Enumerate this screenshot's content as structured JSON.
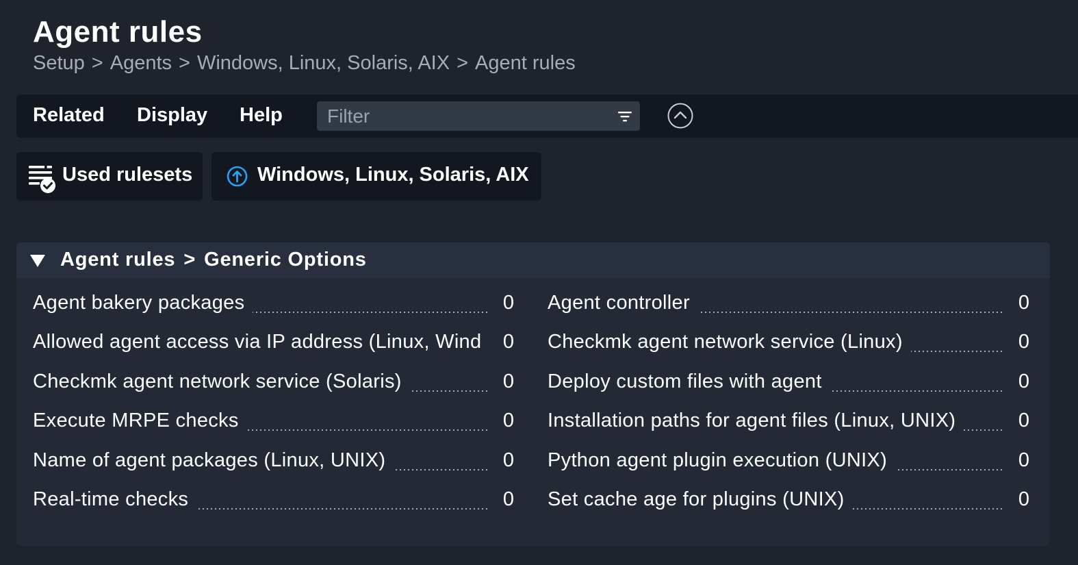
{
  "page": {
    "title": "Agent rules",
    "breadcrumb": [
      "Setup",
      "Agents",
      "Windows, Linux, Solaris, AIX",
      "Agent rules"
    ],
    "breadcrumb_separator": ">"
  },
  "menubar": {
    "items": [
      "Related",
      "Display",
      "Help"
    ],
    "filter_placeholder": "Filter",
    "filter_icon": "filter-lines-icon",
    "collapse_icon": "chevron-up-circle-icon"
  },
  "buttons": [
    {
      "label": "Used rulesets",
      "icon": "ruleset-check-icon"
    },
    {
      "label": "Windows, Linux, Solaris, AIX",
      "icon": "arrow-up-circle-icon"
    }
  ],
  "section": {
    "title_parts": [
      "Agent rules",
      ">",
      "Generic Options"
    ],
    "expanded": true,
    "rules_left": [
      {
        "name": "Agent bakery packages",
        "count": "0"
      },
      {
        "name": "Allowed agent access via IP address (Linux, Wind",
        "count": "0"
      },
      {
        "name": "Checkmk agent network service (Solaris)",
        "count": "0"
      },
      {
        "name": "Execute MRPE checks",
        "count": "0"
      },
      {
        "name": "Name of agent packages (Linux, UNIX)",
        "count": "0"
      },
      {
        "name": "Real-time checks",
        "count": "0"
      }
    ],
    "rules_right": [
      {
        "name": "Agent controller",
        "count": "0"
      },
      {
        "name": "Checkmk agent network service (Linux)",
        "count": "0"
      },
      {
        "name": "Deploy custom files with agent",
        "count": "0"
      },
      {
        "name": "Installation paths for agent files (Linux, UNIX)",
        "count": "0"
      },
      {
        "name": "Python agent plugin execution (UNIX)",
        "count": "0"
      },
      {
        "name": "Set cache age for plugins (UNIX)",
        "count": "0"
      }
    ]
  },
  "colors": {
    "background": "#1e232c",
    "menubar": "#131820",
    "panel": "#232a35",
    "panel_header": "#283040",
    "accent_blue": "#2aa0f0",
    "muted_text": "#a7adb7"
  }
}
